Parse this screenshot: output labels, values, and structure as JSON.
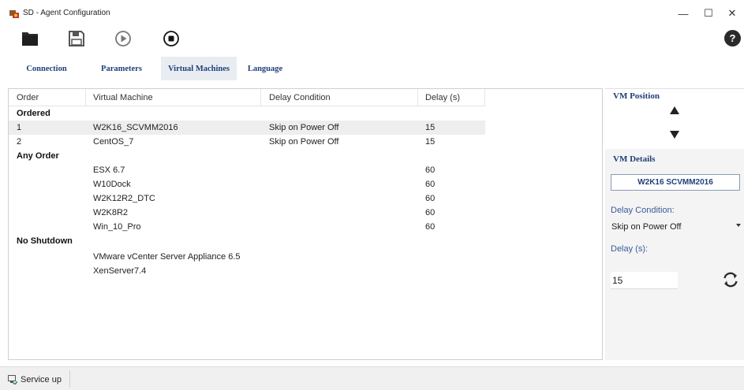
{
  "window": {
    "title": "SD - Agent Configuration",
    "controls": {
      "minimize": "—",
      "maximize": "☐",
      "close": "✕"
    }
  },
  "toolbar": {
    "buttons": [
      "folder-icon",
      "save-icon",
      "play-icon",
      "stop-icon"
    ],
    "help_label": "?"
  },
  "tabs": [
    {
      "label": "Connection",
      "active": false
    },
    {
      "label": "Parameters",
      "active": false
    },
    {
      "label": "Virtual Machines",
      "active": true
    },
    {
      "label": "Language",
      "active": false
    }
  ],
  "grid": {
    "columns": [
      "Order",
      "Virtual Machine",
      "Delay Condition",
      "Delay (s)"
    ],
    "groups": {
      "ordered": {
        "label": "Ordered",
        "rows": [
          {
            "order": "1",
            "vm": "W2K16_SCVMM2016",
            "condition": "Skip on Power Off",
            "delay": "15",
            "selected": true
          },
          {
            "order": "2",
            "vm": "CentOS_7",
            "condition": "Skip on Power Off",
            "delay": "15",
            "selected": false
          }
        ]
      },
      "any_order": {
        "label": "Any Order",
        "rows": [
          {
            "order": "",
            "vm": "ESX 6.7",
            "condition": "",
            "delay": "60"
          },
          {
            "order": "",
            "vm": "W10Dock",
            "condition": "",
            "delay": "60"
          },
          {
            "order": "",
            "vm": "W2K12R2_DTC",
            "condition": "",
            "delay": "60"
          },
          {
            "order": "",
            "vm": "W2K8R2",
            "condition": "",
            "delay": "60"
          },
          {
            "order": "",
            "vm": "Win_10_Pro",
            "condition": "",
            "delay": "60"
          }
        ]
      },
      "no_shutdown": {
        "label": "No Shutdown",
        "rows": [
          {
            "order": "",
            "vm": "VMware vCenter Server Appliance 6.5",
            "condition": "",
            "delay": ""
          },
          {
            "order": "",
            "vm": "XenServer7.4",
            "condition": "",
            "delay": ""
          }
        ]
      }
    }
  },
  "vm_position": {
    "title": "VM Position"
  },
  "vm_details": {
    "title": "VM Details",
    "selected_vm": "W2K16 SCVMM2016",
    "delay_condition_label": "Delay Condition:",
    "delay_condition_value": "Skip on Power Off",
    "delay_label": "Delay (s):",
    "delay_value": "15"
  },
  "status": {
    "text": "Service up"
  },
  "colors": {
    "accent": "#1f3f7a",
    "selected_row": "#eeeeee",
    "status_bar": "#f0f0f0"
  }
}
